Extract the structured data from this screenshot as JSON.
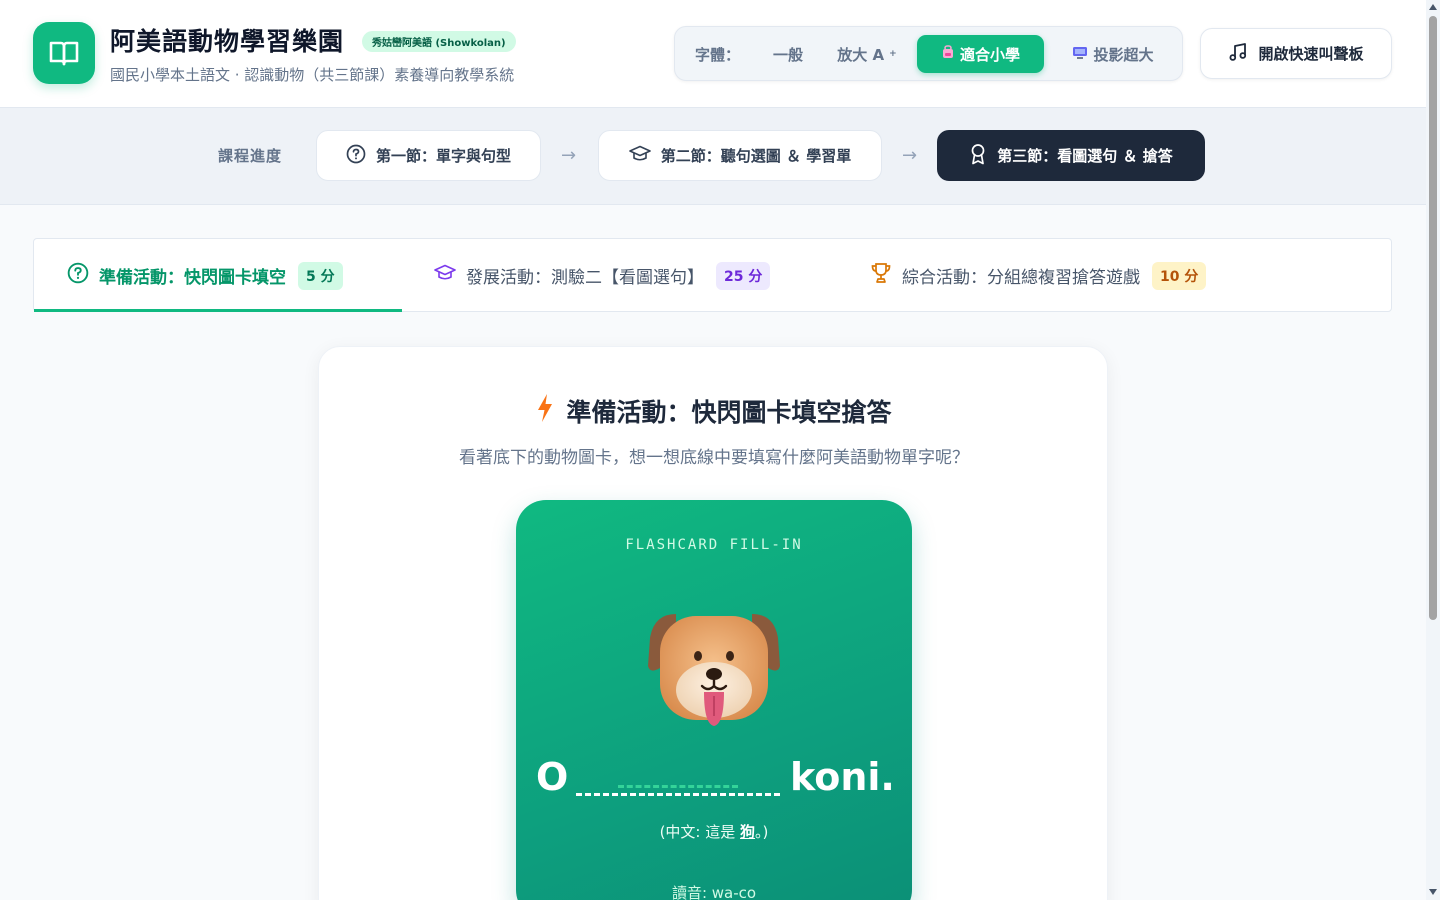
{
  "header": {
    "title": "阿美語動物學習樂園",
    "badge": "秀姑巒阿美語 (Showkolan)",
    "subtitle": "國民小學本土語文 · 認識動物（共三節課）素養導向教學系統",
    "font_size": {
      "label": "字體：",
      "options": [
        {
          "label": "一般",
          "icon": "",
          "active": false
        },
        {
          "label": "放大 A",
          "icon": "superscript-plus",
          "active": false
        },
        {
          "label": "適合小學",
          "icon": "backpack-icon",
          "active": true
        },
        {
          "label": "投影超大",
          "icon": "tv-icon",
          "active": false
        }
      ]
    },
    "soundboard_label": "開啟快速叫聲板"
  },
  "progress": {
    "label": "課程進度",
    "steps": [
      {
        "label": "第一節：單字與句型",
        "icon": "question-circle-icon",
        "active": false
      },
      {
        "label": "第二節：聽句選圖 ＆ 學習單",
        "icon": "graduation-cap-icon",
        "active": false
      },
      {
        "label": "第三節：看圖選句 ＆ 搶答",
        "icon": "award-icon",
        "active": true
      }
    ]
  },
  "activities": [
    {
      "label": "準備活動：快閃圖卡填空",
      "points": "5 分",
      "icon": "question-circle-icon",
      "active": true
    },
    {
      "label": "發展活動：測驗二【看圖選句】",
      "points": "25 分",
      "icon": "graduation-cap-icon",
      "active": false
    },
    {
      "label": "綜合活動：分組總複習搶答遊戲",
      "points": "10 分",
      "icon": "trophy-icon",
      "active": false
    }
  ],
  "card": {
    "title": "準備活動：快閃圖卡填空搶答",
    "description": "看著底下的動物圖卡，想一想底線中要填寫什麼阿美語動物單字呢？",
    "flashcard": {
      "kicker": "FLASHCARD FILL-IN",
      "animal_icon": "dog-face-icon",
      "sentence_before": "O",
      "sentence_after": "koni.",
      "zh_before": "(中文: 這是 ",
      "zh_word": "狗",
      "zh_after": "。)",
      "phonetic": "讀音: wa-co"
    }
  },
  "colors": {
    "primary": "#10b981",
    "dark": "#1e293b",
    "purple": "#7c3aed",
    "amber": "#d97706"
  }
}
